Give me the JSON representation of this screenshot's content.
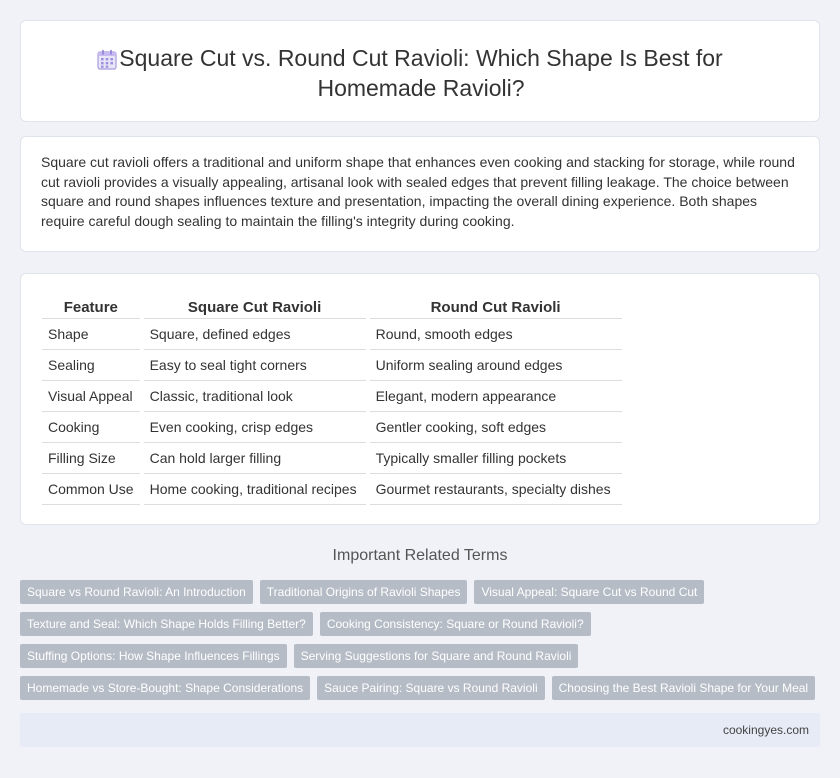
{
  "header": {
    "title": "Square Cut vs. Round Cut Ravioli: Which Shape Is Best for Homemade Ravioli?",
    "icon": "calendar-icon"
  },
  "intro": {
    "text": "Square cut ravioli offers a traditional and uniform shape that enhances even cooking and stacking for storage, while round cut ravioli provides a visually appealing, artisanal look with sealed edges that prevent filling leakage. The choice between square and round shapes influences texture and presentation, impacting the overall dining experience. Both shapes require careful dough sealing to maintain the filling's integrity during cooking."
  },
  "table": {
    "headers": [
      "Feature",
      "Square Cut Ravioli",
      "Round Cut Ravioli"
    ],
    "rows": [
      [
        "Shape",
        "Square, defined edges",
        "Round, smooth edges"
      ],
      [
        "Sealing",
        "Easy to seal tight corners",
        "Uniform sealing around edges"
      ],
      [
        "Visual Appeal",
        "Classic, traditional look",
        "Elegant, modern appearance"
      ],
      [
        "Cooking",
        "Even cooking, crisp edges",
        "Gentler cooking, soft edges"
      ],
      [
        "Filling Size",
        "Can hold larger filling",
        "Typically smaller filling pockets"
      ],
      [
        "Common Use",
        "Home cooking, traditional recipes",
        "Gourmet restaurants, specialty dishes"
      ]
    ]
  },
  "related": {
    "heading": "Important Related Terms",
    "tags": [
      [
        "Square vs Round Ravioli: An Introduction",
        "Traditional Origins of Ravioli Shapes",
        "Visual Appeal: Square Cut vs Round Cut"
      ],
      [
        "Texture and Seal: Which Shape Holds Filling Better?",
        "Cooking Consistency: Square or Round Ravioli?"
      ],
      [
        "Stuffing Options: How Shape Influences Fillings",
        "Serving Suggestions for Square and Round Ravioli"
      ],
      [
        "Homemade vs Store-Bought: Shape Considerations",
        "Sauce Pairing: Square vs Round Ravioli",
        "Choosing the Best Ravioli Shape for Your Meal"
      ]
    ]
  },
  "footer": {
    "site": "cookingyes.com"
  },
  "colors": {
    "background": "#f0f2f7",
    "card": "#ffffff",
    "tag": "#b6bcc6",
    "footer": "#e6ebf5"
  }
}
